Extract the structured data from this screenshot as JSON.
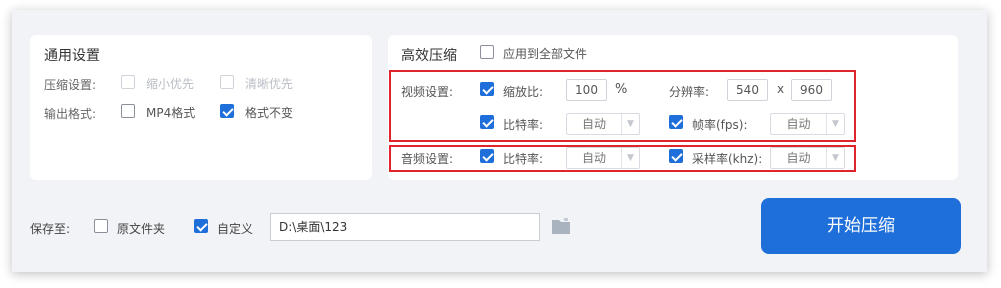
{
  "general": {
    "title": "通用设置",
    "compress_label": "压缩设置:",
    "compress_options": [
      {
        "label": "缩小优先",
        "checked": false,
        "disabled": true
      },
      {
        "label": "清晰优先",
        "checked": false,
        "disabled": true
      }
    ],
    "format_label": "输出格式:",
    "format_options": [
      {
        "label": "MP4格式",
        "checked": false
      },
      {
        "label": "格式不变",
        "checked": true
      }
    ]
  },
  "efficient": {
    "title": "高效压缩",
    "apply_all_label": "应用到全部文件",
    "apply_all_checked": false
  },
  "video": {
    "label": "视频设置:",
    "scale_label": "缩放比:",
    "scale_value": "100",
    "scale_unit": "%",
    "resolution_label": "分辨率:",
    "res_w": "540",
    "res_sep": "x",
    "res_h": "960",
    "bitrate_label": "比特率:",
    "bitrate_value": "自动",
    "fps_label": "帧率(fps):",
    "fps_value": "自动"
  },
  "audio": {
    "label": "音频设置:",
    "bitrate_label": "比特率:",
    "bitrate_value": "自动",
    "samplerate_label": "采样率(khz):",
    "samplerate_value": "自动"
  },
  "save": {
    "label": "保存至:",
    "original_label": "原文件夹",
    "original_checked": false,
    "custom_label": "自定义",
    "custom_checked": true,
    "path": "D:\\桌面\\123"
  },
  "start_button": "开始压缩",
  "colors": {
    "accent": "#1e6fd9",
    "highlight": "#e0242b"
  }
}
